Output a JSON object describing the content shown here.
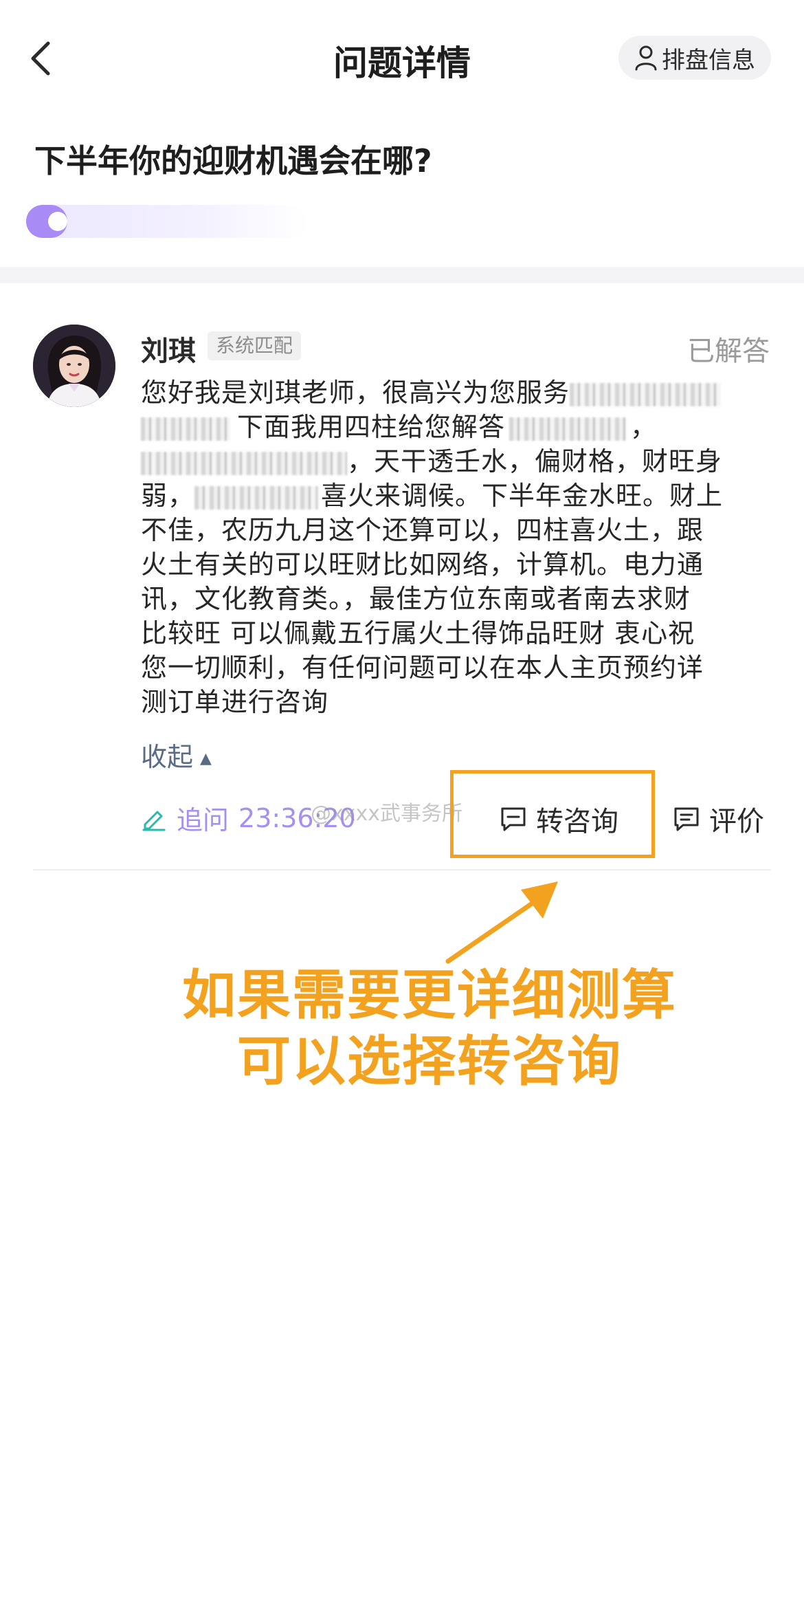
{
  "header": {
    "title": "问题详情",
    "pan_info_label": "排盘信息"
  },
  "question": {
    "text": "下半年你的迎财机遇会在哪?"
  },
  "answer": {
    "master_name": "刘琪",
    "match_tag": "系统匹配",
    "status": "已解答",
    "line1_visible": "您好我是刘琪老师，很高兴为您服务",
    "line2_visible": "下面我用四柱给您解答",
    "line2_end": "，",
    "line3_visible": "，天干透壬水，偏财格，财旺身",
    "line4_start": "弱，",
    "line4_visible": "喜火来调候。下半年金水旺。财上",
    "line5": "不佳，农历九月这个还算可以，四柱喜火土，跟",
    "line6": "火土有关的可以旺财比如网络，计算机。电力通",
    "line7": "讯，文化教育类。，最佳方位东南或者南去求财",
    "line8": "比较旺 可以佩戴五行属火土得饰品旺财 衷心祝",
    "line9": "您一切顺利，有任何问题可以在本人主页预约详",
    "line10": "测订单进行咨询",
    "collapse_label": "收起"
  },
  "actions": {
    "followup_label": "追问",
    "followup_time": "23:36:20",
    "consult_label": "转咨询",
    "rate_label": "评价",
    "watermark": "@xxxx武事务所"
  },
  "annotation": {
    "line1": "如果需要更详细测算",
    "line2": "可以选择转咨询"
  },
  "colors": {
    "accent_purple": "#a88bf5",
    "annotation_orange": "#f2a21e"
  }
}
